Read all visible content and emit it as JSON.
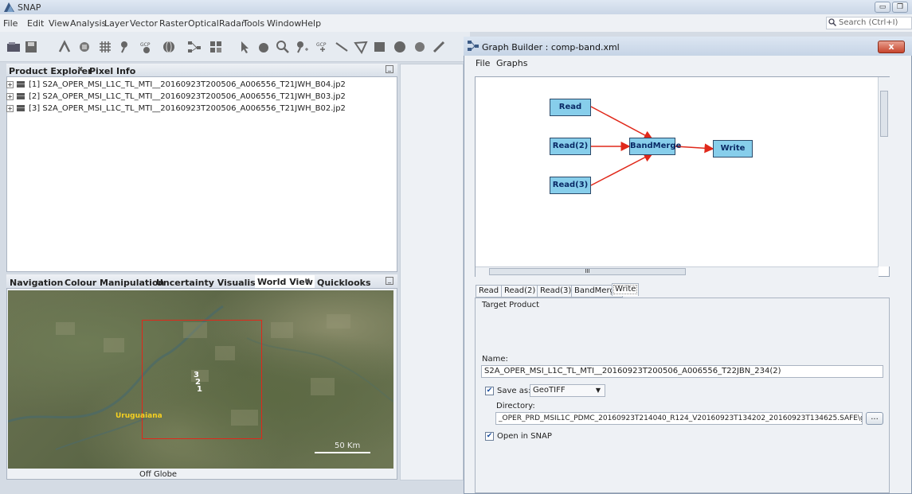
{
  "app": {
    "title": "SNAP"
  },
  "menubar": {
    "items": [
      "File",
      "Edit",
      "View",
      "Analysis",
      "Layer",
      "Vector",
      "Raster",
      "Optical",
      "Radar",
      "Tools",
      "Window",
      "Help"
    ]
  },
  "search": {
    "placeholder": "Search (Ctrl+I)"
  },
  "product_explorer": {
    "tabs": [
      "Product Explorer",
      "Pixel Info"
    ],
    "items": [
      "[1] S2A_OPER_MSI_L1C_TL_MTI__20160923T200506_A006556_T21JWH_B04.jp2",
      "[2] S2A_OPER_MSI_L1C_TL_MTI__20160923T200506_A006556_T21JWH_B03.jp2",
      "[3] S2A_OPER_MSI_L1C_TL_MTI__20160923T200506_A006556_T21JWH_B02.jp2"
    ]
  },
  "world_view": {
    "tabs": [
      "Navigation",
      "Colour Manipulation",
      "Uncertainty Visualisation",
      "World View",
      "Quicklooks"
    ],
    "map_labels": [
      "3",
      "2",
      "1"
    ],
    "place_label": "Uruguaiana",
    "scale_label": "50 Km",
    "status": "Off Globe"
  },
  "graph_builder": {
    "title": "Graph Builder : comp-band.xml",
    "menu": [
      "File",
      "Graphs"
    ],
    "nodes": [
      "Read",
      "Read(2)",
      "Read(3)",
      "BandMerge",
      "Write"
    ],
    "scroll_hint": "III",
    "tabs": [
      "Read",
      "Read(2)",
      "Read(3)",
      "BandMerge",
      "Write"
    ],
    "section_title": "Target Product",
    "name_label": "Name:",
    "name_value": "S2A_OPER_MSI_L1C_TL_MTI__20160923T200506_A006556_T22JBN_234(2)",
    "save_as_label": "Save as:",
    "save_format": "GeoTIFF",
    "directory_label": "Directory:",
    "directory_value": "_OPER_PRD_MSIL1C_PDMC_20160923T214040_R124_V20160923T134202_20160923T134625.SAFE\\geoTIFF",
    "browse_label": "...",
    "open_in_snap_label": "Open in SNAP"
  }
}
